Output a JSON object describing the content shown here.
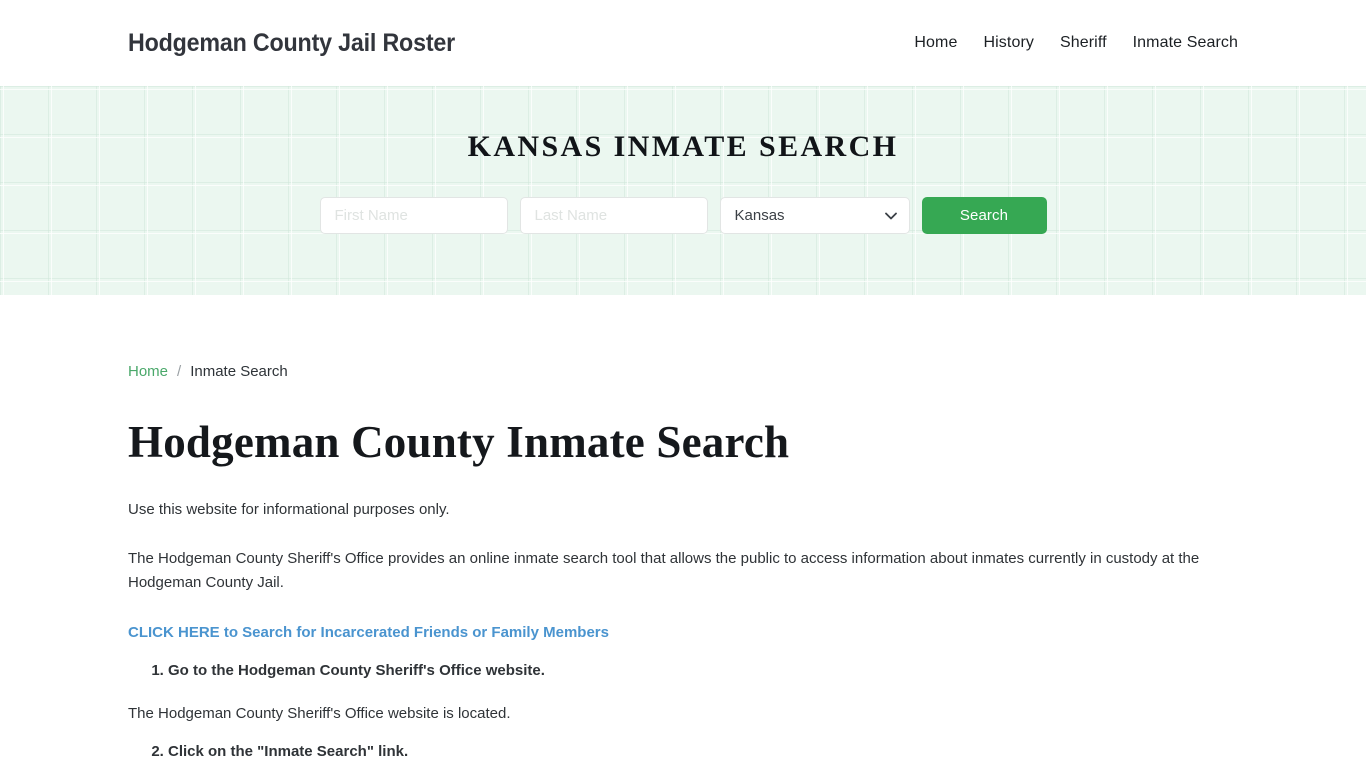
{
  "header": {
    "brand": "Hodgeman County Jail Roster",
    "nav": [
      {
        "label": "Home"
      },
      {
        "label": "History"
      },
      {
        "label": "Sheriff"
      },
      {
        "label": "Inmate Search"
      }
    ]
  },
  "hero": {
    "title": "KANSAS INMATE SEARCH",
    "first_name_placeholder": "First Name",
    "first_name_value": "",
    "last_name_placeholder": "Last Name",
    "last_name_value": "",
    "state_selected": "Kansas",
    "state_options": [
      "Kansas"
    ],
    "search_label": "Search",
    "accent_green": "#36a853",
    "background_green": "#ebf7f0"
  },
  "breadcrumb": {
    "home": "Home",
    "separator": "/",
    "current": "Inmate Search",
    "link_color": "#4aa86a"
  },
  "main": {
    "page_title": "Hodgeman County Inmate Search",
    "intro": "Use this website for informational purposes only.",
    "description": "The Hodgeman County Sheriff's Office provides an online inmate search tool that allows the public to access information about inmates currently in custody at the Hodgeman County Jail.",
    "cta_link": "CLICK HERE to Search for Incarcerated Friends or Family Members",
    "cta_color": "#4a94cf",
    "step_one": "Go to the Hodgeman County Sheriff's Office website.",
    "step_one_note": "The Hodgeman County Sheriff's Office website is located.",
    "step_two": "Click on the \"Inmate Search\" link."
  },
  "icons": {
    "chevron_down": "chevron-down-icon"
  }
}
